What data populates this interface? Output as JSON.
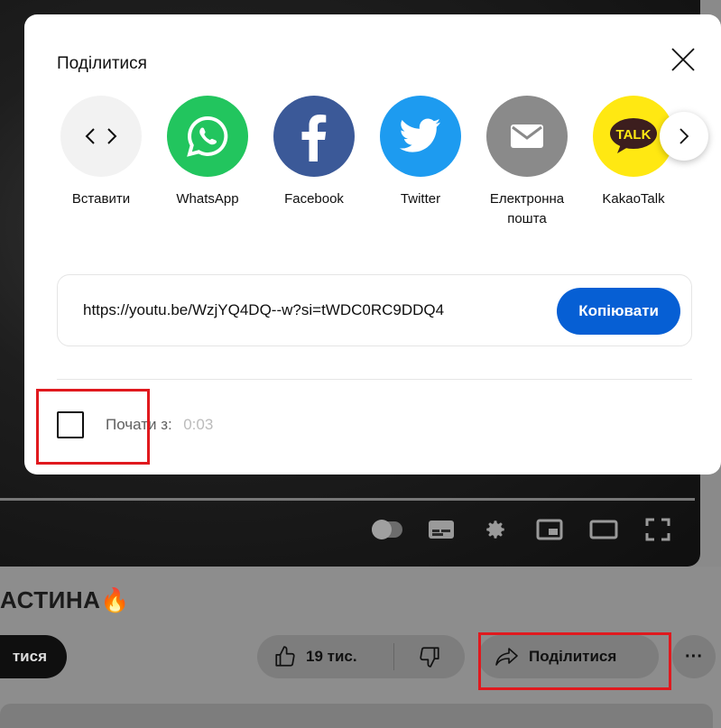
{
  "dialog": {
    "title": "Поділитися",
    "share_targets": [
      {
        "label": "Вставити",
        "icon": "embed-code-icon"
      },
      {
        "label": "WhatsApp",
        "icon": "whatsapp-icon"
      },
      {
        "label": "Facebook",
        "icon": "facebook-icon"
      },
      {
        "label": "Twitter",
        "icon": "twitter-icon"
      },
      {
        "label": "Електронна\nпошта",
        "icon": "email-icon"
      },
      {
        "label": "KakaoTalk",
        "icon": "kakaotalk-icon",
        "badge": "TALK"
      }
    ],
    "link": "https://youtu.be/WzjYQ4DQ--w?si=tWDC0RC9DDQ4",
    "copy_label": "Копіювати",
    "start_label": "Почати з:",
    "start_time": "0:03",
    "start_checked": false
  },
  "page": {
    "video_title_fragment": "АСТИНА",
    "subscribe_fragment": "тися",
    "likes": "19 тис.",
    "share_label": "Поділитися",
    "more_label": "···"
  },
  "colors": {
    "copy_button": "#065fd4",
    "whatsapp": "#22c55e",
    "facebook": "#3b5998",
    "twitter": "#1d9bf0",
    "email": "#8a8a8a",
    "kakaotalk": "#ffe812",
    "highlight": "#e0191e"
  }
}
